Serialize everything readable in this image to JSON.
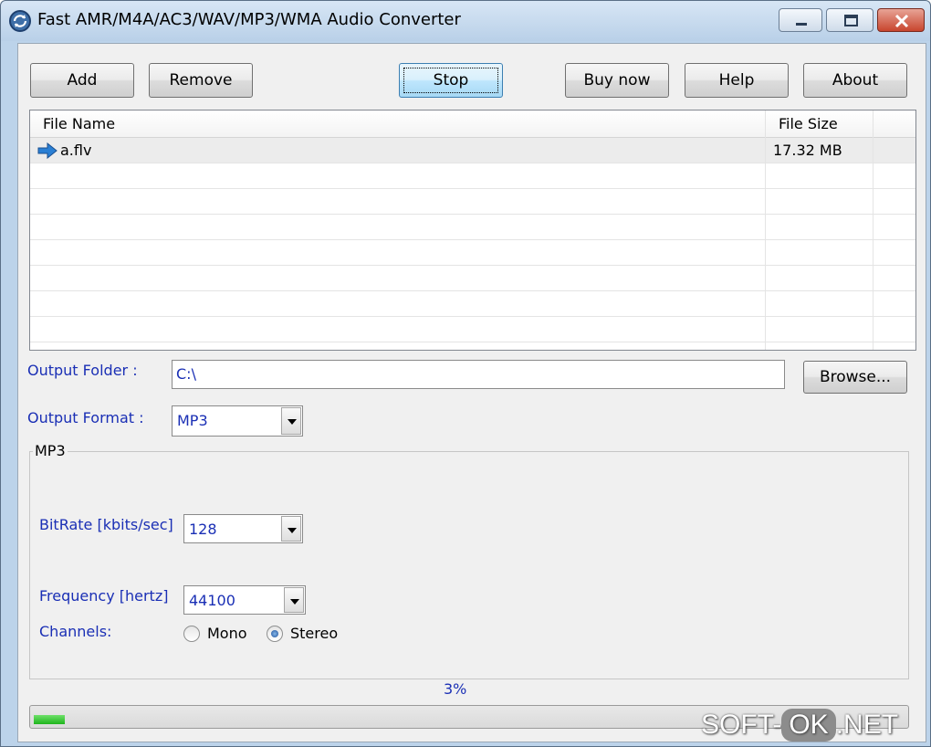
{
  "window": {
    "title": "Fast AMR/M4A/AC3/WAV/MP3/WMA Audio Converter"
  },
  "toolbar": {
    "add_label": "Add",
    "remove_label": "Remove",
    "stop_label": "Stop",
    "buy_label": "Buy now",
    "help_label": "Help",
    "about_label": "About"
  },
  "file_list": {
    "columns": [
      "File Name",
      "File Size"
    ],
    "rows": [
      {
        "name": "a.flv",
        "size": "17.32 MB"
      }
    ]
  },
  "output": {
    "folder_label": "Output Folder :",
    "folder_value": "C:\\",
    "browse_label": "Browse...",
    "format_label": "Output Format :",
    "format_value": "MP3"
  },
  "mp3_group": {
    "title": "MP3",
    "bitrate_label": "BitRate [kbits/sec]",
    "bitrate_value": "128",
    "frequency_label": "Frequency [hertz]",
    "frequency_value": "44100",
    "channels_label": "Channels:",
    "channel_options": [
      "Mono",
      "Stereo"
    ],
    "channel_selected": "Stereo"
  },
  "progress": {
    "percent_text": "3%",
    "fraction": 0.03
  },
  "watermark": {
    "left": "SOFT-",
    "middle": "OK",
    "right": ".NET"
  },
  "colors": {
    "label_blue": "#1a2fb5",
    "progress_green": "#1fb51c",
    "list_arrow": "#2a7fd4"
  },
  "icons": {
    "app": "converter-app-icon",
    "row_status": "arrow-right-icon"
  }
}
